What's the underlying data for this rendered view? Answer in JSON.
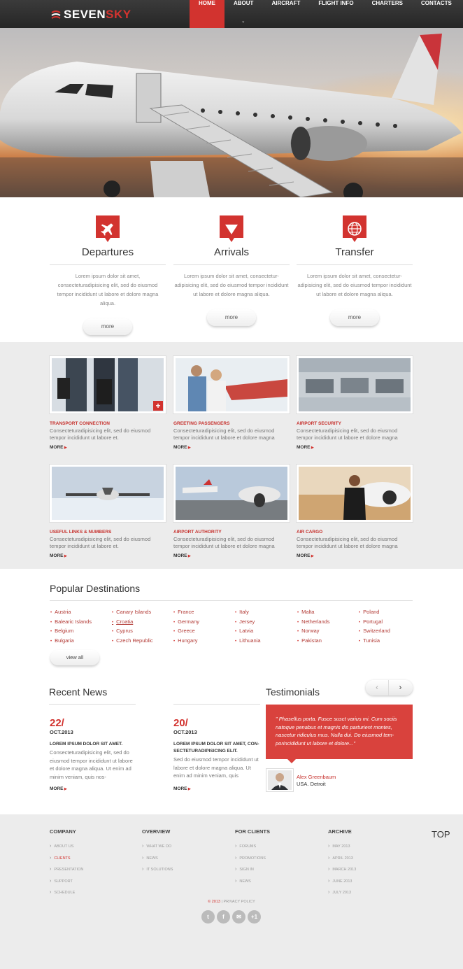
{
  "brand": {
    "part1": "SEVEN",
    "part2": "SKY"
  },
  "nav": [
    {
      "label": "HOME",
      "active": true
    },
    {
      "label": "ABOUT",
      "active": false
    },
    {
      "label": "AIRCRAFT",
      "active": false
    },
    {
      "label": "FLIGHT INFO",
      "active": false
    },
    {
      "label": "CHARTERS",
      "active": false
    },
    {
      "label": "CONTACTS",
      "active": false
    }
  ],
  "slider": {
    "slides": 3,
    "active_index": 0
  },
  "services": [
    {
      "title": "Departures",
      "icon": "plane-icon",
      "text": "Lorem ipsum dolor sit amet, consecteturadipisicing elit, sed do eiusmod tempor incididunt ut labore et dolore magna aliqua.",
      "more": "more"
    },
    {
      "title": "Arrivals",
      "icon": "arrow-down-icon",
      "text": "Lorem ipsum dolor sit amet, consectetur-adipisicing elit, sed do eiusmod tempor incididunt ut labore et dolore magna aliqua.",
      "more": "more"
    },
    {
      "title": "Transfer",
      "icon": "globe-icon",
      "text": "Lorem ipsum dolor sit amet, consectetur-adipisicing elit, sed do eiusmod tempor incididunt ut labore et dolore magna aliqua.",
      "more": "more"
    }
  ],
  "cards": [
    {
      "title": "TRANSPORT CONNECTION",
      "text": "Consecteturadipisicing elit, sed do eiusmod tempor incididunt ut labore et.",
      "more": "MORE"
    },
    {
      "title": "GREETING PASSENGERS",
      "text": "Consecteturadipisicing elit, sed do eiusmod tempor incididunt ut labore et dolore magna",
      "more": "MORE"
    },
    {
      "title": "AIRPORT SECURITY",
      "text": "Consecteturadipisicing elit, sed do eiusmod tempor incididunt ut labore et dolore magna",
      "more": "MORE"
    },
    {
      "title": "USEFUL LINKS & NUMBERS",
      "text": "Consecteturadipisicing elit, sed do eiusmod tempor incididunt ut labore et.",
      "more": "MORE"
    },
    {
      "title": "AIRPORT AUTHORITY",
      "text": "Consecteturadipisicing elit, sed do eiusmod tempor incididunt ut labore et dolore magna",
      "more": "MORE"
    },
    {
      "title": "AIR CARGO",
      "text": "Consecteturadipisicing elit, sed do eiusmod tempor incididunt ut labore et dolore magna",
      "more": "MORE"
    }
  ],
  "destinations": {
    "title": "Popular Destinations",
    "columns": [
      [
        "Austria",
        "Balearic Islands",
        "Belgium",
        "Bulgaria"
      ],
      [
        "Canary Islands",
        "Croatia",
        "Cyprus",
        "Czech Republic"
      ],
      [
        "France",
        "Germany",
        "Greece",
        "Hungary"
      ],
      [
        "Italy",
        "Jersey",
        "Latvia",
        "Lithuania"
      ],
      [
        "Malta",
        "Netherlands",
        "Norway",
        "Pakistan"
      ],
      [
        "Poland",
        "Portugal",
        "Switzerland",
        "Tunisia"
      ]
    ],
    "view_all": "view all"
  },
  "news": {
    "title": "Recent News",
    "items": [
      {
        "day": "22/",
        "month": "OCT.2013",
        "headline": "LOREM IPSUM DOLOR SIT AMET.",
        "text": "Consecteturadipisicing elit, sed do eiusmod tempor incididunt ut labore et dolore magna aliqua. Ut enim ad minim veniam, quis nos-",
        "more": "MORE"
      },
      {
        "day": "20/",
        "month": "OCT.2013",
        "headline": "LOREM IPSUM DOLOR SIT AMET, CON-SECTETURADIPISICING ELIT.",
        "text": "Sed do eiusmod tempor incididunt ut labore et dolore magna aliqua. Ut enim ad minim veniam, quis",
        "more": "MORE"
      }
    ]
  },
  "testimonials": {
    "title": "Testimonials",
    "prev": "‹",
    "next": "›",
    "quote": "\" Phasellus porta. Fusce susct varius mi. Cum sociis natoque penabus et magnis dis parturient montes, nascetur ridiculus mus. Nulla dui. Do eiusmod tem-porincididunt ut labore et dolore...\"",
    "author": "Alex Greenbaum",
    "location": "USA. Detroit"
  },
  "footer": {
    "columns": [
      {
        "head": "COMPANY",
        "items": [
          "ABOUT US",
          "CLIENTS",
          "PRESENTATION",
          "SUPPORT",
          "SCHEDULE"
        ],
        "active": 1
      },
      {
        "head": "OVERVIEW",
        "items": [
          "WHAT WE DO",
          "NEWS",
          "IT SOLUTIONS"
        ],
        "active": -1
      },
      {
        "head": "FOR CLIENTS",
        "items": [
          "FORUMS",
          "PROMOTIONS",
          "SIGN IN",
          "NEWS"
        ],
        "active": -1
      },
      {
        "head": "ARCHIVE",
        "items": [
          "MAY 2013",
          "APRIL 2013",
          "MARCH 2013",
          "JUNE 2013",
          "JULY 2013"
        ],
        "active": -1
      }
    ],
    "top": "TOP",
    "copyright_year": "© 2013",
    "privacy": "PRIVACY POLICY",
    "socials": [
      {
        "icon": "twitter-icon",
        "glyph": "t"
      },
      {
        "icon": "facebook-icon",
        "glyph": "f"
      },
      {
        "icon": "mail-icon",
        "glyph": "✉"
      },
      {
        "icon": "google-plus-icon",
        "glyph": "+1"
      }
    ]
  },
  "colors": {
    "accent": "#d2332f",
    "dark": "#2b2b2b",
    "band": "#ececec"
  }
}
